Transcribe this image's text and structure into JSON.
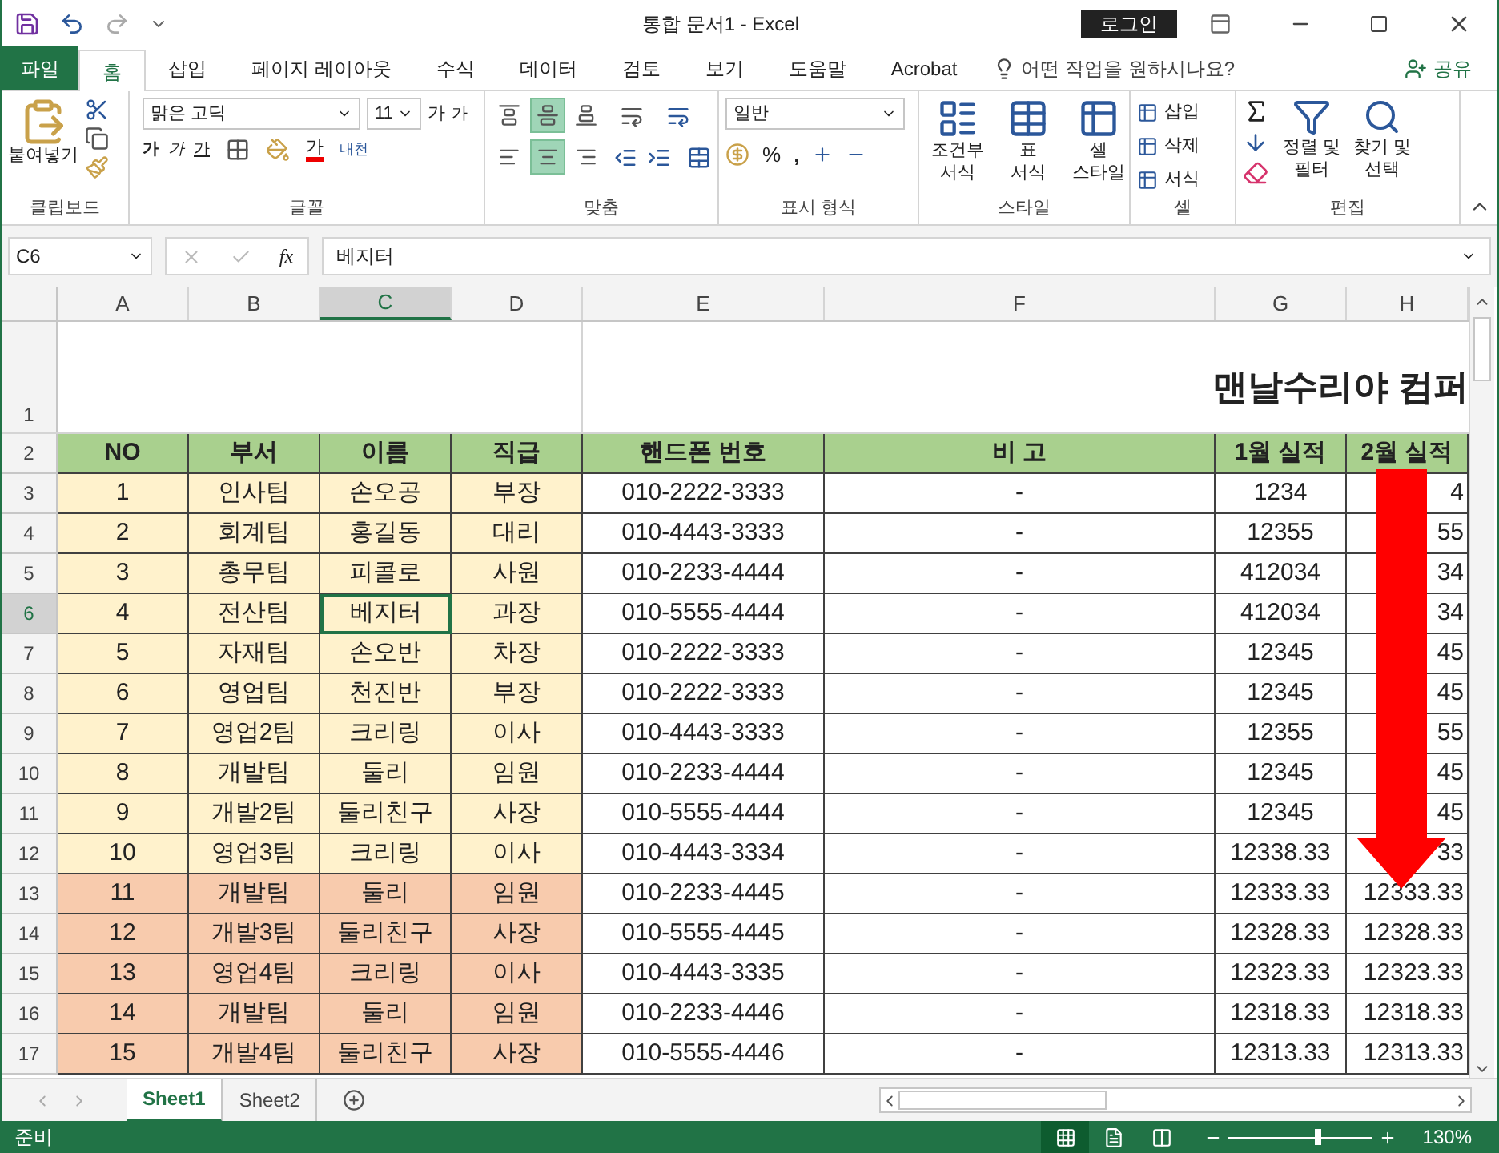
{
  "title_bar": {
    "title": "통합 문서1  -  Excel",
    "login": "로그인"
  },
  "ribbon_tabs": [
    {
      "label": "파일",
      "kind": "file",
      "selected": false
    },
    {
      "label": "홈",
      "kind": "tab",
      "selected": true
    },
    {
      "label": "삽입",
      "kind": "tab",
      "selected": false
    },
    {
      "label": "페이지 레이아웃",
      "kind": "tab",
      "selected": false
    },
    {
      "label": "수식",
      "kind": "tab",
      "selected": false
    },
    {
      "label": "데이터",
      "kind": "tab",
      "selected": false
    },
    {
      "label": "검토",
      "kind": "tab",
      "selected": false
    },
    {
      "label": "보기",
      "kind": "tab",
      "selected": false
    },
    {
      "label": "도움말",
      "kind": "tab",
      "selected": false
    },
    {
      "label": "Acrobat",
      "kind": "tab",
      "selected": false
    }
  ],
  "tell_me": "어떤 작업을 원하시나요?",
  "share": "공유",
  "ribbon": {
    "clipboard": {
      "label": "클립보드",
      "paste": "붙여넣기"
    },
    "font": {
      "label": "글꼴",
      "font_name": "맑은 고딕",
      "font_size": "11",
      "grow": "가",
      "shrink": "가",
      "bold": "가",
      "italic": "가",
      "underline": "가",
      "font_color": "가",
      "phonetic": "내천"
    },
    "alignment": {
      "label": "맞춤",
      "vertical": [
        {
          "selected": false
        },
        {
          "selected": true
        },
        {
          "selected": false
        }
      ],
      "horizontal": [
        {
          "selected": false
        },
        {
          "selected": true
        },
        {
          "selected": false
        }
      ]
    },
    "number": {
      "label": "표시 형식",
      "format": "일반",
      "percent": "%",
      "comma": ","
    },
    "styles": {
      "label": "스타일",
      "buttons": [
        {
          "lines": [
            "조건부",
            "서식"
          ]
        },
        {
          "lines": [
            "표",
            "서식"
          ]
        },
        {
          "lines": [
            "셀",
            "스타일"
          ]
        }
      ]
    },
    "cells": {
      "label": "셀",
      "buttons": [
        "삽입",
        "삭제",
        "서식"
      ]
    },
    "editing": {
      "label": "편집",
      "buttons": [
        {
          "lines": [
            "정렬 및",
            "필터"
          ]
        },
        {
          "lines": [
            "찾기 및",
            "선택"
          ]
        }
      ]
    }
  },
  "formula_bar": {
    "name_box": "C6",
    "function_label": "fx",
    "value": "베지터"
  },
  "sheet": {
    "columns": [
      {
        "label": "A",
        "selected": false
      },
      {
        "label": "B",
        "selected": false
      },
      {
        "label": "C",
        "selected": true
      },
      {
        "label": "D",
        "selected": false
      },
      {
        "label": "E",
        "selected": false
      },
      {
        "label": "F",
        "selected": false
      },
      {
        "label": "G",
        "selected": false
      },
      {
        "label": "H",
        "selected": false
      }
    ],
    "title_row": {
      "number": "1",
      "title": "맨날수리야 컴퍼"
    },
    "header_row": {
      "number": "2",
      "cells": [
        "NO",
        "부서",
        "이름",
        "직급",
        "핸드폰 번호",
        "비 고",
        "1월 실적",
        "2월 실적"
      ]
    },
    "rows": [
      {
        "number": "3",
        "color": "#fff2cc",
        "selected": false,
        "cells": [
          "1",
          "인사팀",
          "손오공",
          "부장",
          "010-2222-3333",
          "-",
          "1234",
          "4"
        ]
      },
      {
        "number": "4",
        "color": "#fff2cc",
        "selected": false,
        "cells": [
          "2",
          "회계팀",
          "홍길동",
          "대리",
          "010-4443-3333",
          "-",
          "12355",
          "55"
        ]
      },
      {
        "number": "5",
        "color": "#fff2cc",
        "selected": false,
        "cells": [
          "3",
          "총무팀",
          "피콜로",
          "사원",
          "010-2233-4444",
          "-",
          "412034",
          "34"
        ]
      },
      {
        "number": "6",
        "color": "#fff2cc",
        "selected": true,
        "cells": [
          "4",
          "전산팀",
          "베지터",
          "과장",
          "010-5555-4444",
          "-",
          "412034",
          "34"
        ]
      },
      {
        "number": "7",
        "color": "#fff2cc",
        "selected": false,
        "cells": [
          "5",
          "자재팀",
          "손오반",
          "차장",
          "010-2222-3333",
          "-",
          "12345",
          "45"
        ]
      },
      {
        "number": "8",
        "color": "#fff2cc",
        "selected": false,
        "cells": [
          "6",
          "영업팀",
          "천진반",
          "부장",
          "010-2222-3333",
          "-",
          "12345",
          "45"
        ]
      },
      {
        "number": "9",
        "color": "#fff2cc",
        "selected": false,
        "cells": [
          "7",
          "영업2팀",
          "크리링",
          "이사",
          "010-4443-3333",
          "-",
          "12355",
          "55"
        ]
      },
      {
        "number": "10",
        "color": "#fff2cc",
        "selected": false,
        "cells": [
          "8",
          "개발팀",
          "둘리",
          "임원",
          "010-2233-4444",
          "-",
          "12345",
          "45"
        ]
      },
      {
        "number": "11",
        "color": "#fff2cc",
        "selected": false,
        "cells": [
          "9",
          "개발2팀",
          "둘리친구",
          "사장",
          "010-5555-4444",
          "-",
          "12345",
          "45"
        ]
      },
      {
        "number": "12",
        "color": "#fff2cc",
        "selected": false,
        "cells": [
          "10",
          "영업3팀",
          "크리링",
          "이사",
          "010-4443-3334",
          "-",
          "12338.33",
          "33"
        ]
      },
      {
        "number": "13",
        "color": "#f8cbad",
        "selected": false,
        "cells": [
          "11",
          "개발팀",
          "둘리",
          "임원",
          "010-2233-4445",
          "-",
          "12333.33",
          "12333.33"
        ]
      },
      {
        "number": "14",
        "color": "#f8cbad",
        "selected": false,
        "cells": [
          "12",
          "개발3팀",
          "둘리친구",
          "사장",
          "010-5555-4445",
          "-",
          "12328.33",
          "12328.33"
        ]
      },
      {
        "number": "15",
        "color": "#f8cbad",
        "selected": false,
        "cells": [
          "13",
          "영업4팀",
          "크리링",
          "이사",
          "010-4443-3335",
          "-",
          "12323.33",
          "12323.33"
        ]
      },
      {
        "number": "16",
        "color": "#f8cbad",
        "selected": false,
        "cells": [
          "14",
          "개발팀",
          "둘리",
          "임원",
          "010-2233-4446",
          "-",
          "12318.33",
          "12318.33"
        ]
      },
      {
        "number": "17",
        "color": "#f8cbad",
        "selected": false,
        "cells": [
          "15",
          "개발4팀",
          "둘리친구",
          "사장",
          "010-5555-4446",
          "-",
          "12313.33",
          "12313.33"
        ]
      }
    ]
  },
  "sheet_tabs": [
    {
      "label": "Sheet1",
      "selected": true
    },
    {
      "label": "Sheet2",
      "selected": false
    }
  ],
  "status_bar": {
    "text": "준비",
    "views": [
      {
        "selected": true
      },
      {
        "selected": false
      },
      {
        "selected": false
      }
    ],
    "zoom_slider": {
      "level": 0.62
    },
    "zoom": "130%"
  }
}
